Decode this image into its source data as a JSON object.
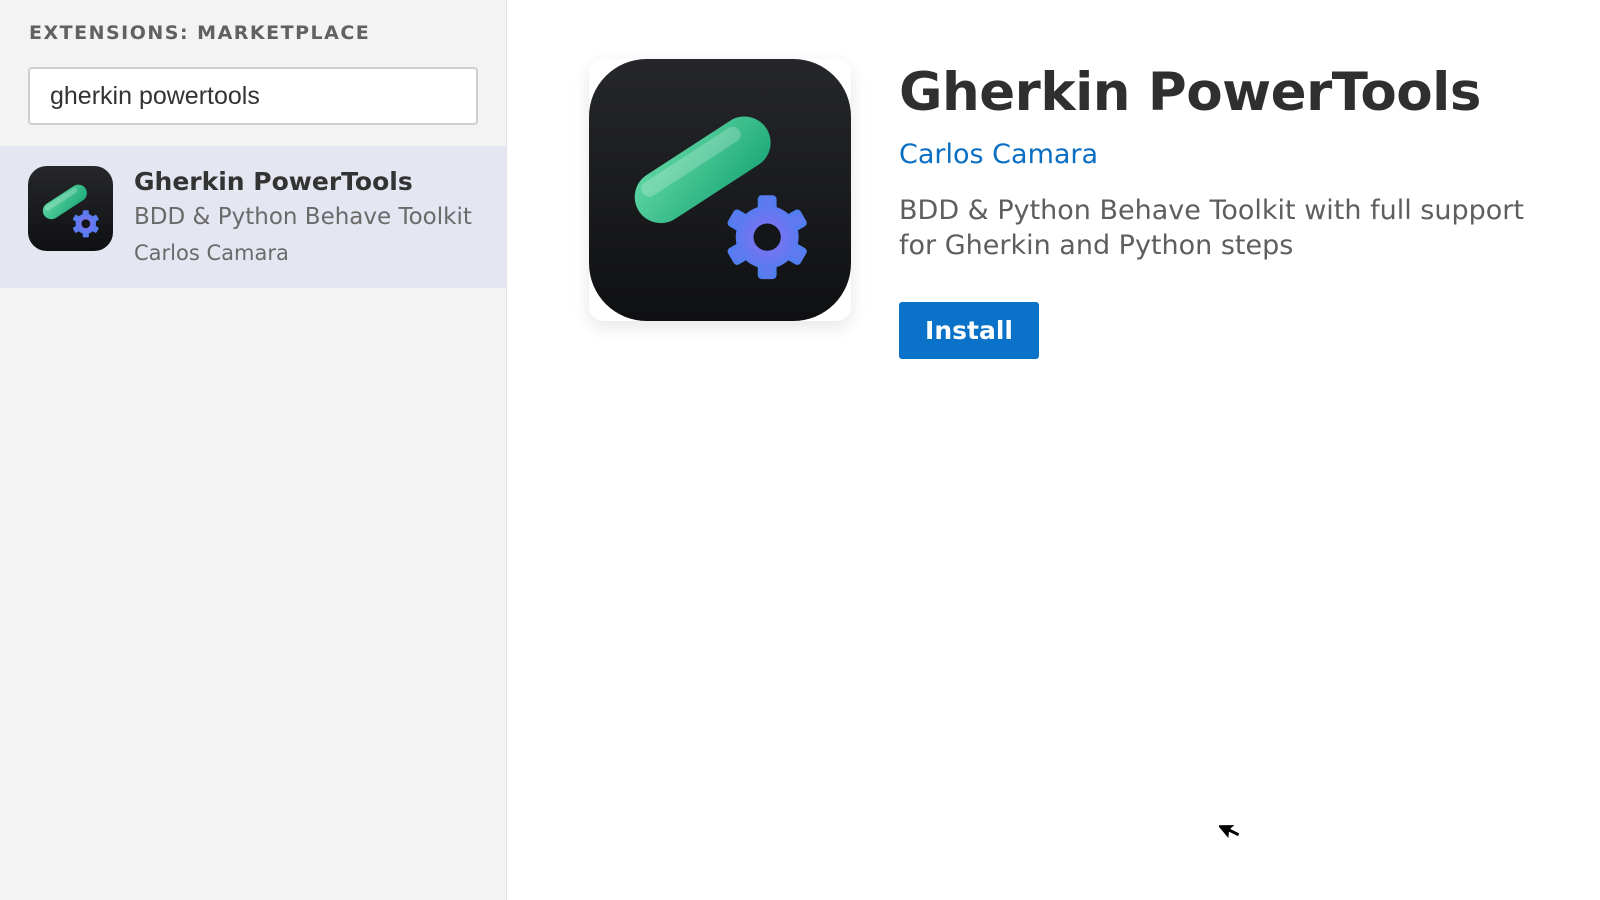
{
  "sidebar": {
    "title": "EXTENSIONS: MARKETPLACE",
    "search": {
      "value": "gherkin powertools",
      "placeholder": ""
    },
    "results": [
      {
        "name": "Gherkin PowerTools",
        "description": "BDD & Python Behave Toolkit",
        "publisher": "Carlos Camara",
        "icon": "gherkin-powertools-logo-icon",
        "selected": true
      }
    ]
  },
  "detail": {
    "icon": "gherkin-powertools-logo-icon",
    "title": "Gherkin PowerTools",
    "publisher": "Carlos Camara",
    "description": "BDD & Python Behave Toolkit with full support for Gherkin and Python steps",
    "install_label": "Install"
  },
  "colors": {
    "accent": "#0a72c9",
    "link": "#0a6fc2",
    "selected_bg": "#e4e6f1",
    "sidebar_bg": "#f3f3f3"
  }
}
